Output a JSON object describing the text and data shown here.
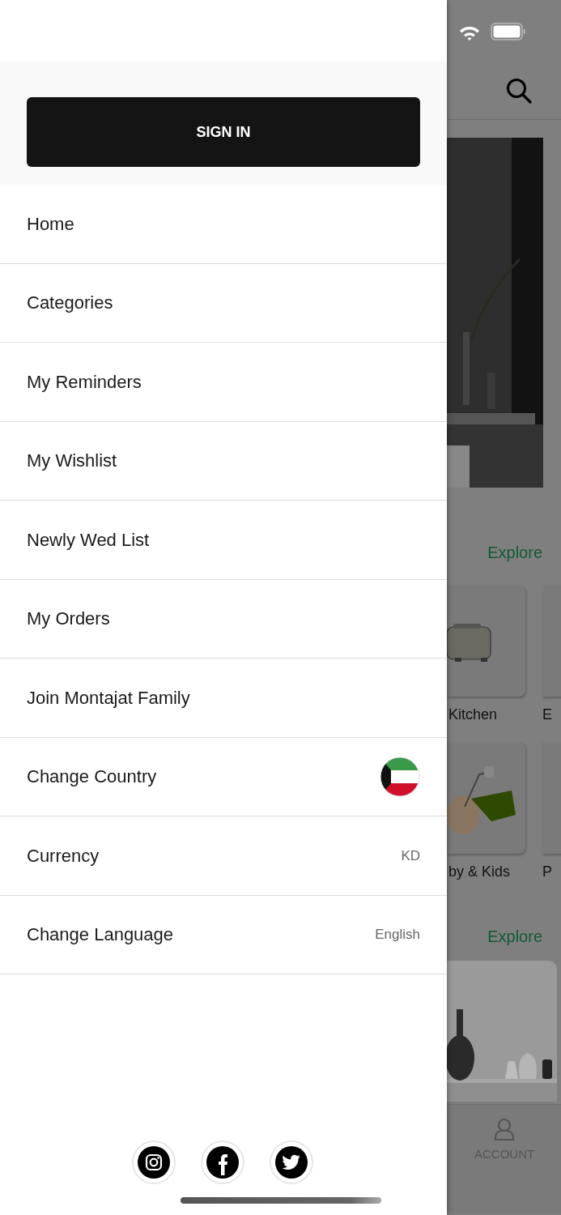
{
  "drawer": {
    "sign_in_button": "SIGN IN",
    "menu": [
      {
        "label": "Home",
        "kind": "plain"
      },
      {
        "label": "Categories",
        "kind": "plain"
      },
      {
        "label": "My Reminders",
        "kind": "plain"
      },
      {
        "label": "My Wishlist",
        "kind": "plain"
      },
      {
        "label": "Newly Wed List",
        "kind": "plain"
      },
      {
        "label": "My Orders",
        "kind": "plain"
      },
      {
        "label": "Join Montajat Family",
        "kind": "plain"
      },
      {
        "label": "Change Country",
        "kind": "flag"
      },
      {
        "label": "Currency",
        "kind": "value",
        "value": "KD"
      },
      {
        "label": "Change Language",
        "kind": "value",
        "value": "English"
      }
    ]
  },
  "background_screen": {
    "explore_links": [
      "Explore",
      "Explore"
    ],
    "category_rows": [
      [
        {
          "label": "Kitchen"
        },
        {
          "label": "E"
        }
      ],
      [
        {
          "label": "by & Kids"
        },
        {
          "label": "P"
        }
      ]
    ],
    "tab_bar": [
      {
        "label": "ACCOUNT"
      }
    ]
  }
}
